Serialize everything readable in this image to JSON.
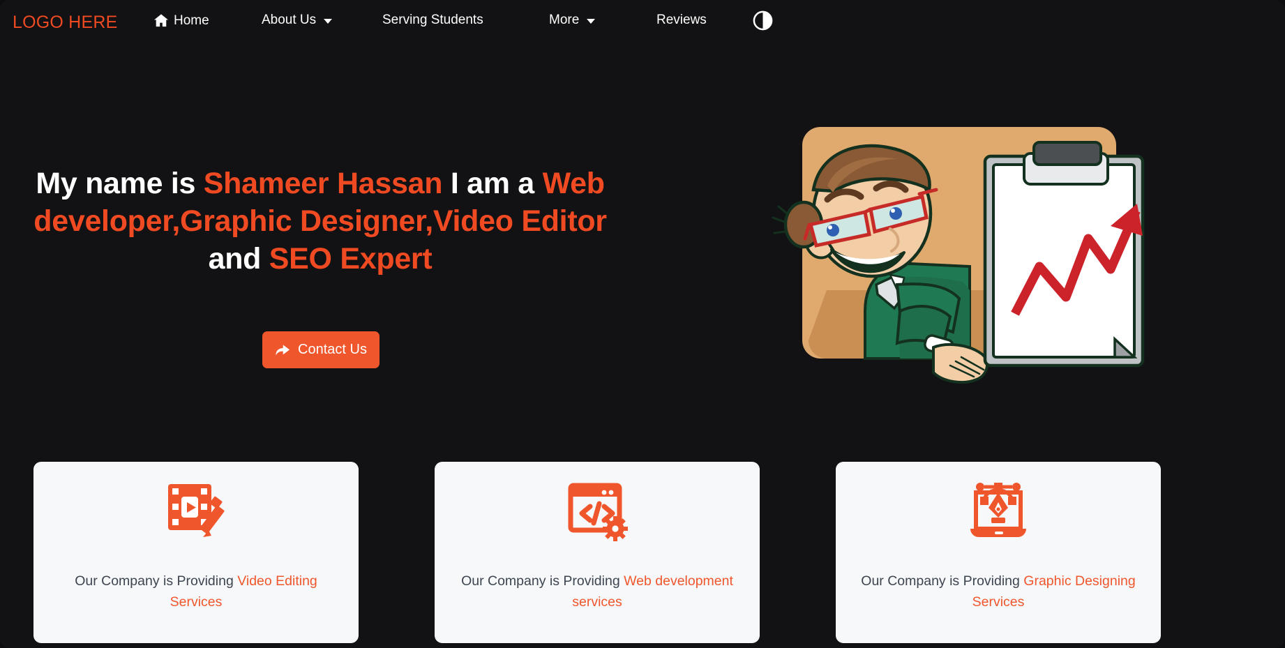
{
  "site": {
    "logo_text": "LOGO HERE",
    "logo_color": "#f04a23",
    "background_color": "#121214",
    "accent_color": "#f0562c"
  },
  "navbar": {
    "items": [
      {
        "label": "Home",
        "icon": "home-icon",
        "has_dropdown": false
      },
      {
        "label": "About Us",
        "icon": null,
        "has_dropdown": true
      },
      {
        "label": "Serving Students",
        "icon": null,
        "has_dropdown": false
      },
      {
        "label": "More",
        "icon": null,
        "has_dropdown": true
      },
      {
        "label": "Reviews",
        "icon": null,
        "has_dropdown": false
      }
    ],
    "theme_toggle": {
      "icon": "circle-half-fill-icon",
      "label": "Toggle dark mode"
    }
  },
  "hero": {
    "headline": {
      "part1": "My name is ",
      "name": "Shameer Hassan",
      "part2": " I am a",
      "line2": "Web developer,Graphic Designer,Video Editor",
      "connector": " and ",
      "line3": "SEO Expert"
    },
    "cta": {
      "label": "Contact Us",
      "icon": "share-arrow-icon"
    },
    "illustration": {
      "name": "man-presenting-clipboard-chart",
      "description": "Cartoon man with glasses in green suit presenting a clipboard showing a rising red arrow chart",
      "panel_color": "#e0a96d",
      "suit_color": "#1f7a52",
      "arrow_color": "#cc2229"
    }
  },
  "cards": [
    {
      "icon": "film-strip-pencil-icon",
      "prefix": "Our Company is Providing ",
      "accent": "Video Editing Services"
    },
    {
      "icon": "code-window-gear-icon",
      "prefix": "Our Company is Providing ",
      "accent": "Web development services"
    },
    {
      "icon": "laptop-pen-tool-icon",
      "prefix": "Our Company is Providing ",
      "accent": "Graphic Designing Services"
    }
  ]
}
